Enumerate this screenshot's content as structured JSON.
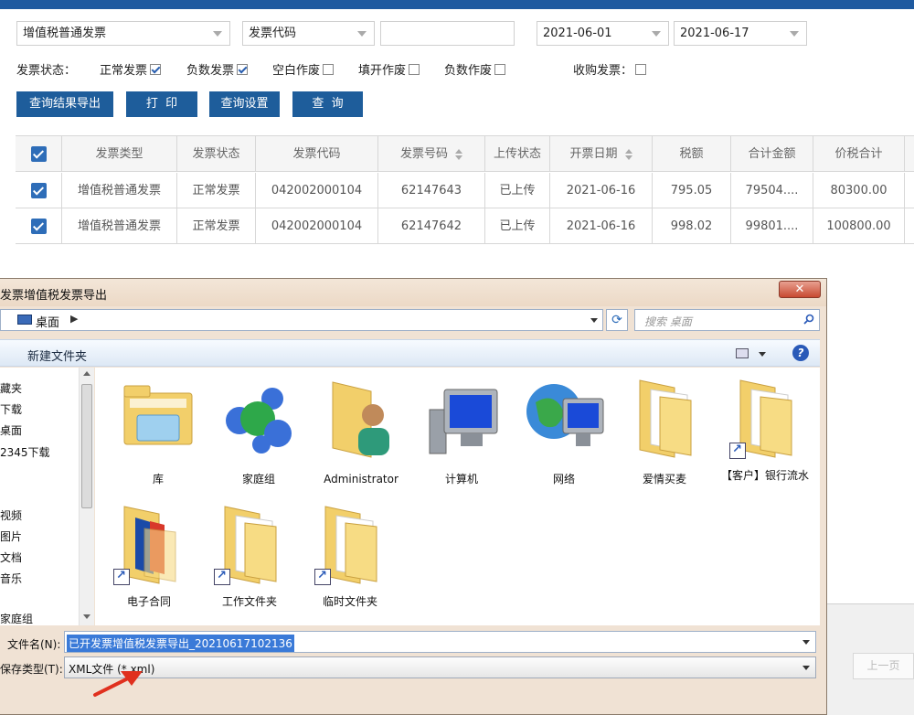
{
  "filters": {
    "invoice_type": "增值税普通发票",
    "code_field": "发票代码",
    "code_value": "",
    "date_from": "2021-06-01",
    "date_to": "2021-06-17"
  },
  "status": {
    "label": "发票状态：",
    "options": [
      {
        "label": "正常发票",
        "checked": true
      },
      {
        "label": "负数发票",
        "checked": true
      },
      {
        "label": "空白作废",
        "checked": false
      },
      {
        "label": "填开作废",
        "checked": false
      },
      {
        "label": "负数作废",
        "checked": false
      }
    ],
    "purchase_label": "收购发票：",
    "purchase_checked": false
  },
  "buttons": {
    "export": "查询结果导出",
    "print": "打  印",
    "settings": "查询设置",
    "query": "查  询"
  },
  "table": {
    "columns": [
      "发票类型",
      "发票状态",
      "发票代码",
      "发票号码",
      "上传状态",
      "开票日期",
      "税额",
      "合计金额",
      "价税合计"
    ],
    "rows": [
      [
        "增值税普通发票",
        "正常发票",
        "042002000104",
        "62147643",
        "已上传",
        "2021-06-16",
        "795.05",
        "79504....",
        "80300.00"
      ],
      [
        "增值税普通发票",
        "正常发票",
        "042002000104",
        "62147642",
        "已上传",
        "2021-06-16",
        "998.02",
        "99801....",
        "100800.00"
      ]
    ]
  },
  "pager": {
    "prev": "上一页"
  },
  "dialog": {
    "title": "发票增值税发票导出",
    "close": "✕",
    "address": "桌面",
    "search_placeholder": "搜索 桌面",
    "new_folder": "新建文件夹",
    "nav": [
      "藏夹",
      "下载",
      "桌面",
      "2345下载",
      "视频",
      "图片",
      "文档",
      "音乐",
      "家庭组"
    ],
    "items": [
      {
        "label": "库",
        "icon": "library-folder-icon"
      },
      {
        "label": "家庭组",
        "icon": "homegroup-icon"
      },
      {
        "label": "Administrator",
        "icon": "user-folder-icon"
      },
      {
        "label": "计算机",
        "icon": "computer-icon"
      },
      {
        "label": "网络",
        "icon": "network-icon"
      },
      {
        "label": "爱情买麦",
        "icon": "folder-icon"
      },
      {
        "label": "【客户】银行流水",
        "icon": "folder-shortcut-icon"
      },
      {
        "label": "电子合同",
        "icon": "folder-shortcut-icon"
      },
      {
        "label": "工作文件夹",
        "icon": "folder-shortcut-icon"
      },
      {
        "label": "临时文件夹",
        "icon": "folder-shortcut-icon"
      }
    ],
    "filename_label": "文件名(N):",
    "filename": "已开发票增值税发票导出_20210617102136",
    "filetype_label": "保存类型(T):",
    "filetype": "XML文件 (*.xml)"
  },
  "colors": {
    "accent": "#1e5d9b",
    "checkbox": "#2e6db8",
    "arrow": "#e0301e"
  }
}
